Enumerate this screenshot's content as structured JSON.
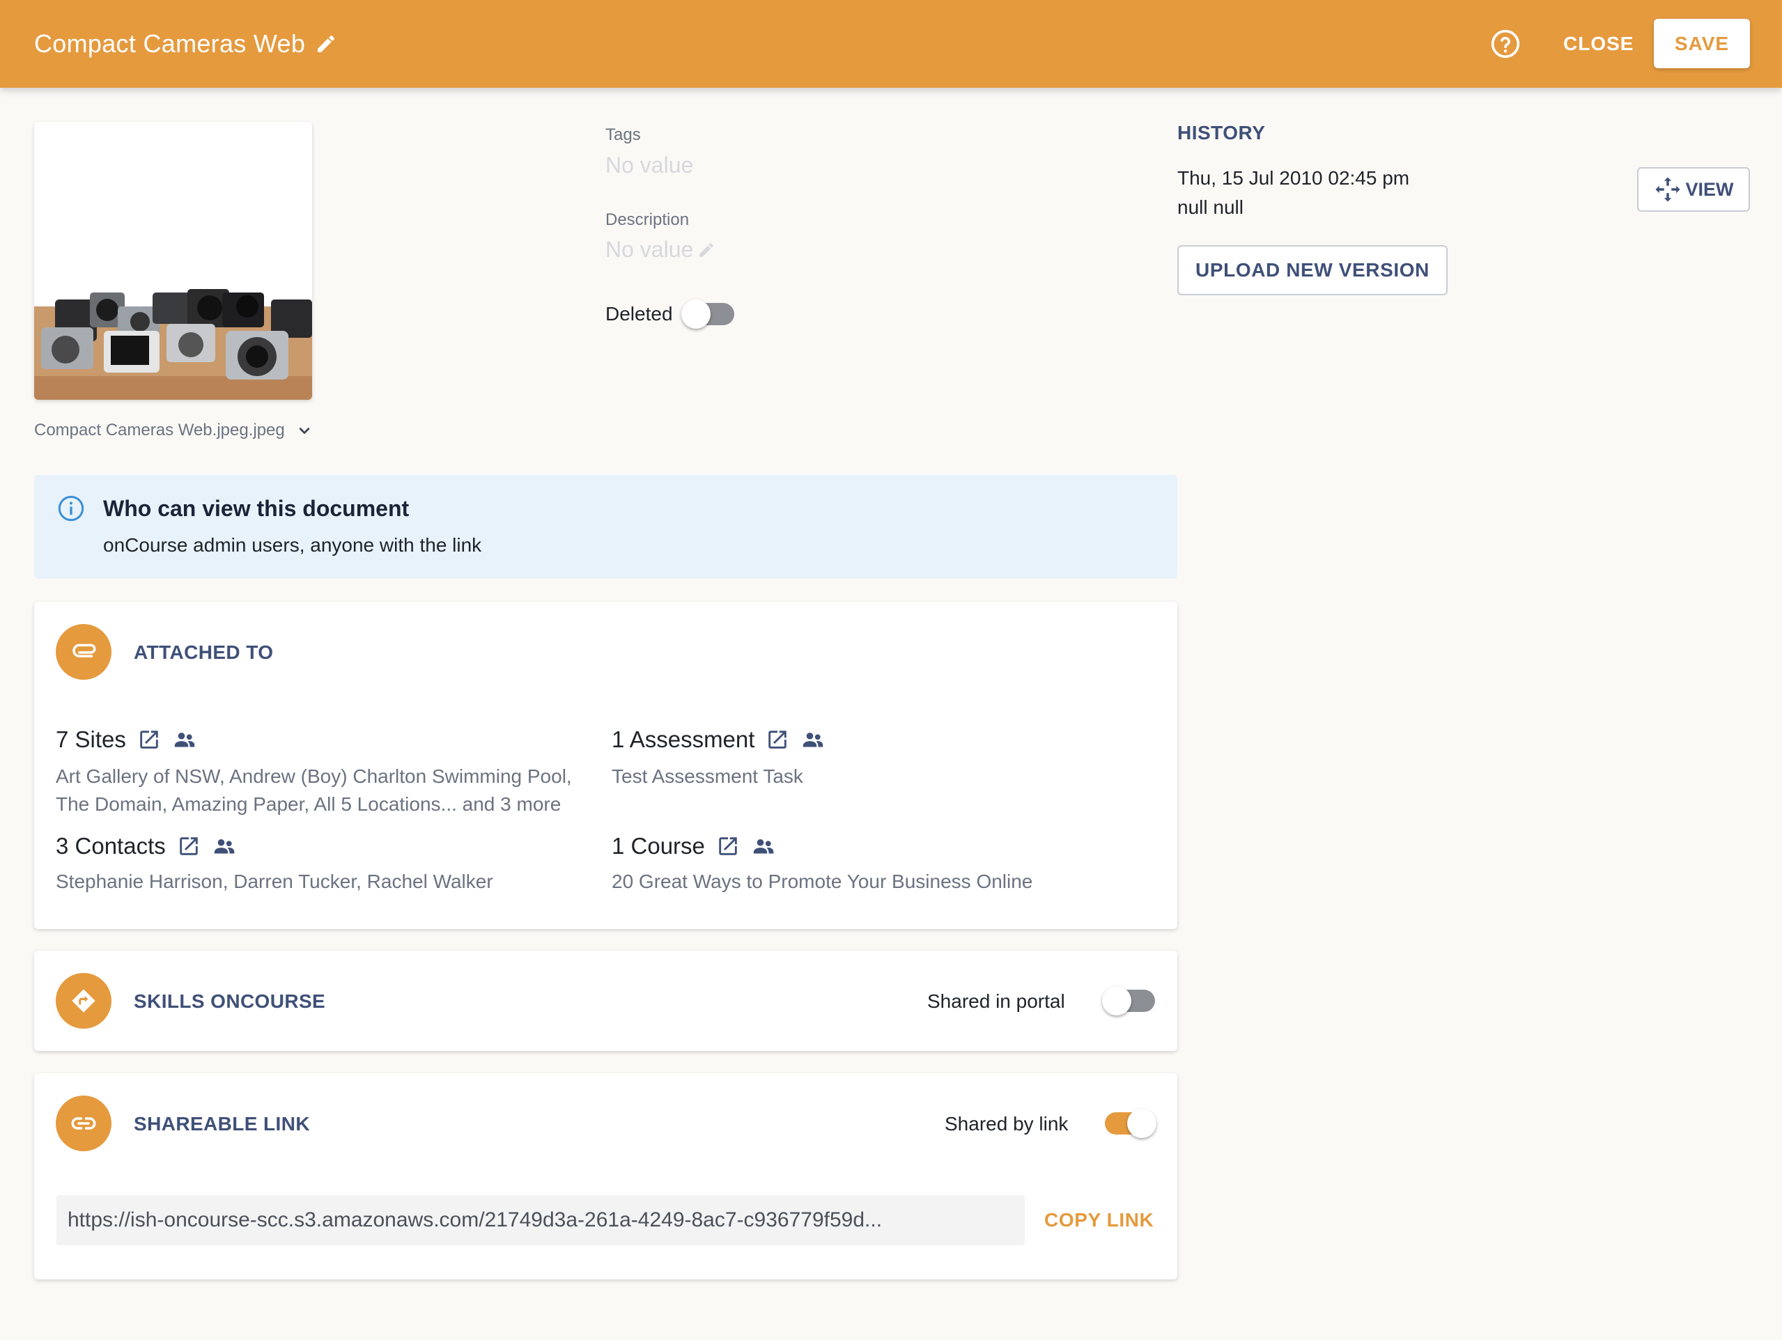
{
  "header": {
    "title": "Compact Cameras Web",
    "close_label": "CLOSE",
    "save_label": "SAVE",
    "accent_color": "#e59a3e"
  },
  "document": {
    "file_name": "Compact Cameras Web.jpeg.jpeg",
    "tags_label": "Tags",
    "tags_value": "No value",
    "description_label": "Description",
    "description_value": "No value",
    "deleted_label": "Deleted",
    "deleted": false
  },
  "history": {
    "title": "HISTORY",
    "date": "Thu, 15 Jul 2010 02:45 pm",
    "user": "null null",
    "view_label": "VIEW",
    "upload_label": "UPLOAD NEW VERSION"
  },
  "visibility": {
    "title": "Who can view this document",
    "text": "onCourse admin users, anyone with the link"
  },
  "attached": {
    "title": "ATTACHED TO",
    "items": [
      {
        "heading": "7 Sites",
        "desc_lines": [
          "Art Gallery of NSW, Andrew (Boy) Charlton Swimming Pool,",
          "The Domain, Amazing Paper, All 5 Locations... and 3 more"
        ]
      },
      {
        "heading": "1 Assessment",
        "desc_lines": [
          "Test Assessment Task"
        ]
      },
      {
        "heading": "3 Contacts",
        "desc_lines": [
          "Stephanie Harrison, Darren Tucker, Rachel Walker"
        ]
      },
      {
        "heading": "1 Course",
        "desc_lines": [
          "20 Great Ways to Promote Your Business Online"
        ]
      }
    ]
  },
  "skills": {
    "title": "SKILLS ONCOURSE",
    "toggle_label": "Shared in portal",
    "shared": false
  },
  "shareable": {
    "title": "SHAREABLE LINK",
    "toggle_label": "Shared by link",
    "shared": true,
    "url": "https://ish-oncourse-scc.s3.amazonaws.com/21749d3a-261a-4249-8ac7-c936779f59d...",
    "copy_label": "COPY LINK"
  }
}
